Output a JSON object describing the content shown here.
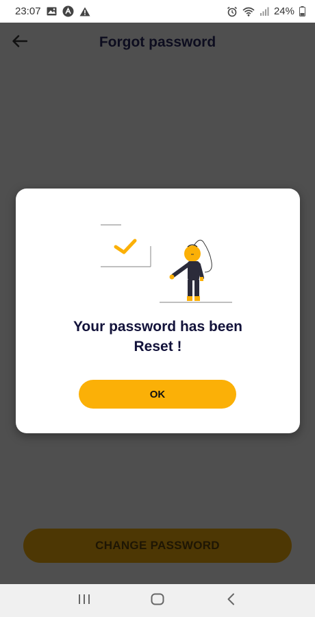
{
  "status_bar": {
    "time": "23:07",
    "battery": "24%"
  },
  "app_bar": {
    "title": "Forgot password"
  },
  "dialog": {
    "message_line1": "Your password has been",
    "message_line2": "Reset !",
    "ok_label": "OK"
  },
  "main": {
    "change_password_label": "CHANGE PASSWORD"
  },
  "colors": {
    "accent": "#fbb007",
    "scrim_background": "#4f4f4f",
    "heading": "#12123a"
  },
  "icons": [
    "image-icon",
    "app-notification-icon",
    "warning-icon",
    "alarm-icon",
    "wifi-icon",
    "signal-icon",
    "battery-icon",
    "back-arrow-icon",
    "recent-apps-icon",
    "home-icon",
    "back-icon"
  ]
}
